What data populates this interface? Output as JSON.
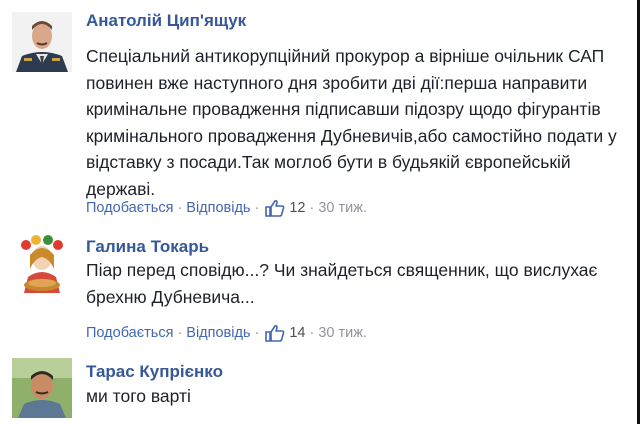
{
  "colors": {
    "link": "#365899",
    "action_link": "#4267b2",
    "body_text": "#1d2129",
    "meta_text": "#90949c"
  },
  "comments": [
    {
      "author": "Анатолій Цип'ящук",
      "avatar": "man-in-uniform-avatar",
      "lines": [
        "Спеціальний антикорупційний прокурор а вірніше очільник САП",
        "повинен вже наступного дня зробити дві дії:перша направити",
        "кримінальне провадження підписавши підозру щодо фігурантів",
        "кримінального провадження Дубневичів,або самостійно подати у",
        "відставку з посади.Так моглоб бути в будьякій європейській",
        "державі."
      ],
      "like_label": "Подобається",
      "reply_label": "Відповідь",
      "like_icon": "thumbs-up-icon",
      "like_count": "12",
      "time": "30 тиж."
    },
    {
      "author": "Галина Токарь",
      "avatar": "folk-girl-with-bread-avatar",
      "lines": [
        "Піар перед сповідю...? Чи знайдеться священник, що вислухає",
        "брехню Дубневича..."
      ],
      "like_label": "Подобається",
      "reply_label": "Відповідь",
      "like_icon": "thumbs-up-icon",
      "like_count": "14",
      "time": "30 тиж."
    },
    {
      "author": "Тарас Купрієнко",
      "avatar": "man-outdoors-avatar",
      "lines": [
        "ми того варті"
      ]
    }
  ]
}
